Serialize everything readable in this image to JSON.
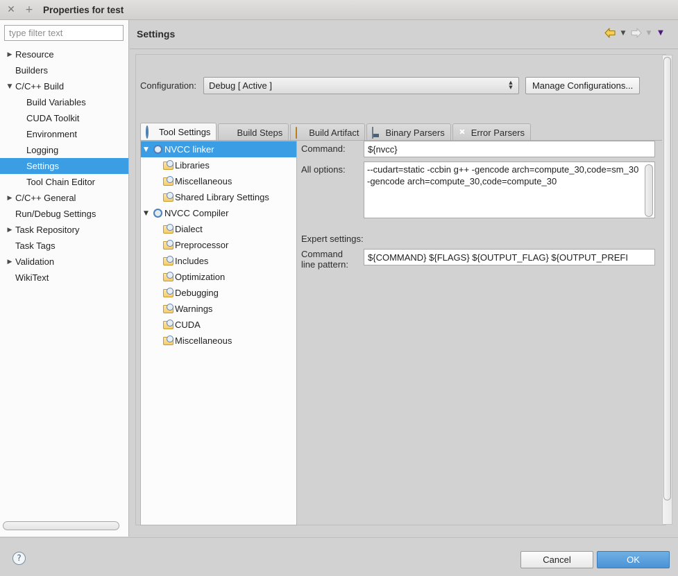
{
  "window": {
    "title": "Properties for test",
    "close_icon": "close-icon",
    "maximize_icon": "plus-icon"
  },
  "sidebar": {
    "filter": {
      "placeholder": "type filter text",
      "value": "",
      "clear_icon": "clear-icon"
    },
    "items": [
      {
        "label": "Resource",
        "level": 1,
        "twisty": "collapsed",
        "selected": false
      },
      {
        "label": "Builders",
        "level": 1,
        "twisty": "none",
        "selected": false
      },
      {
        "label": "C/C++ Build",
        "level": 1,
        "twisty": "expanded",
        "selected": false
      },
      {
        "label": "Build Variables",
        "level": 2,
        "twisty": "none",
        "selected": false
      },
      {
        "label": "CUDA Toolkit",
        "level": 2,
        "twisty": "none",
        "selected": false
      },
      {
        "label": "Environment",
        "level": 2,
        "twisty": "none",
        "selected": false
      },
      {
        "label": "Logging",
        "level": 2,
        "twisty": "none",
        "selected": false
      },
      {
        "label": "Settings",
        "level": 2,
        "twisty": "none",
        "selected": true
      },
      {
        "label": "Tool Chain Editor",
        "level": 2,
        "twisty": "none",
        "selected": false
      },
      {
        "label": "C/C++ General",
        "level": 1,
        "twisty": "collapsed",
        "selected": false
      },
      {
        "label": "Run/Debug Settings",
        "level": 1,
        "twisty": "none",
        "selected": false
      },
      {
        "label": "Task Repository",
        "level": 1,
        "twisty": "collapsed",
        "selected": false
      },
      {
        "label": "Task Tags",
        "level": 1,
        "twisty": "none",
        "selected": false
      },
      {
        "label": "Validation",
        "level": 1,
        "twisty": "collapsed",
        "selected": false
      },
      {
        "label": "WikiText",
        "level": 1,
        "twisty": "none",
        "selected": false
      }
    ],
    "selection_color": "#3b9ee5"
  },
  "header": {
    "title": "Settings",
    "nav": {
      "back_icon": "back-arrow-icon",
      "back_menu_icon": "chevron-down-icon",
      "forward_icon": "forward-arrow-icon",
      "forward_menu_icon": "chevron-down-icon",
      "view_menu_icon": "chevron-down-icon"
    }
  },
  "configuration": {
    "label": "Configuration:",
    "value": "Debug  [ Active ]",
    "spinner_icon": "spinner-icon",
    "manage_button": "Manage Configurations..."
  },
  "tabs": [
    {
      "label": "Tool Settings",
      "icon": "tool-settings-icon",
      "active": true
    },
    {
      "label": "Build Steps",
      "icon": "wrench-icon",
      "active": false
    },
    {
      "label": "Build Artifact",
      "icon": "artifact-icon",
      "active": false
    },
    {
      "label": "Binary Parsers",
      "icon": "binary-doc-icon",
      "active": false
    },
    {
      "label": "Error Parsers",
      "icon": "error-icon",
      "active": false
    }
  ],
  "tool_tree": [
    {
      "label": "NVCC linker",
      "level": 1,
      "twisty": "expanded",
      "icon": "tool-icon",
      "selected": true
    },
    {
      "label": "Libraries",
      "level": 2,
      "twisty": "none",
      "icon": "folder-icon",
      "selected": false
    },
    {
      "label": "Miscellaneous",
      "level": 2,
      "twisty": "none",
      "icon": "folder-icon",
      "selected": false
    },
    {
      "label": "Shared Library Settings",
      "level": 2,
      "twisty": "none",
      "icon": "folder-icon",
      "selected": false
    },
    {
      "label": "NVCC Compiler",
      "level": 1,
      "twisty": "expanded",
      "icon": "tool-icon",
      "selected": false
    },
    {
      "label": "Dialect",
      "level": 2,
      "twisty": "none",
      "icon": "folder-icon",
      "selected": false
    },
    {
      "label": "Preprocessor",
      "level": 2,
      "twisty": "none",
      "icon": "folder-icon",
      "selected": false
    },
    {
      "label": "Includes",
      "level": 2,
      "twisty": "none",
      "icon": "folder-icon",
      "selected": false
    },
    {
      "label": "Optimization",
      "level": 2,
      "twisty": "none",
      "icon": "folder-icon",
      "selected": false
    },
    {
      "label": "Debugging",
      "level": 2,
      "twisty": "none",
      "icon": "folder-icon",
      "selected": false
    },
    {
      "label": "Warnings",
      "level": 2,
      "twisty": "none",
      "icon": "folder-icon",
      "selected": false
    },
    {
      "label": "CUDA",
      "level": 2,
      "twisty": "none",
      "icon": "folder-icon",
      "selected": false
    },
    {
      "label": "Miscellaneous",
      "level": 2,
      "twisty": "none",
      "icon": "folder-icon",
      "selected": false
    }
  ],
  "form": {
    "command_label": "Command:",
    "command_value": "${nvcc}",
    "all_options_label": "All options:",
    "all_options_value": "--cudart=static -ccbin g++ -gencode arch=compute_30,code=sm_30 -gencode arch=compute_30,code=compute_30",
    "expert_label": "Expert settings:",
    "pattern_label_line1": "Command",
    "pattern_label_line2": "line pattern:",
    "pattern_value": "${COMMAND} ${FLAGS} ${OUTPUT_FLAG} ${OUTPUT_PREFI"
  },
  "footer": {
    "help_icon": "help-icon",
    "help_glyph": "?",
    "cancel_label": "Cancel",
    "ok_label": "OK",
    "ok_color": "#4b93d6"
  },
  "glyphs": {
    "collapsed": "▶",
    "expanded": "▼",
    "chevron_down": "▼",
    "close": "✕",
    "plus": "+",
    "clear": "⌫",
    "spin_up": "▲",
    "spin_down": "▼"
  }
}
